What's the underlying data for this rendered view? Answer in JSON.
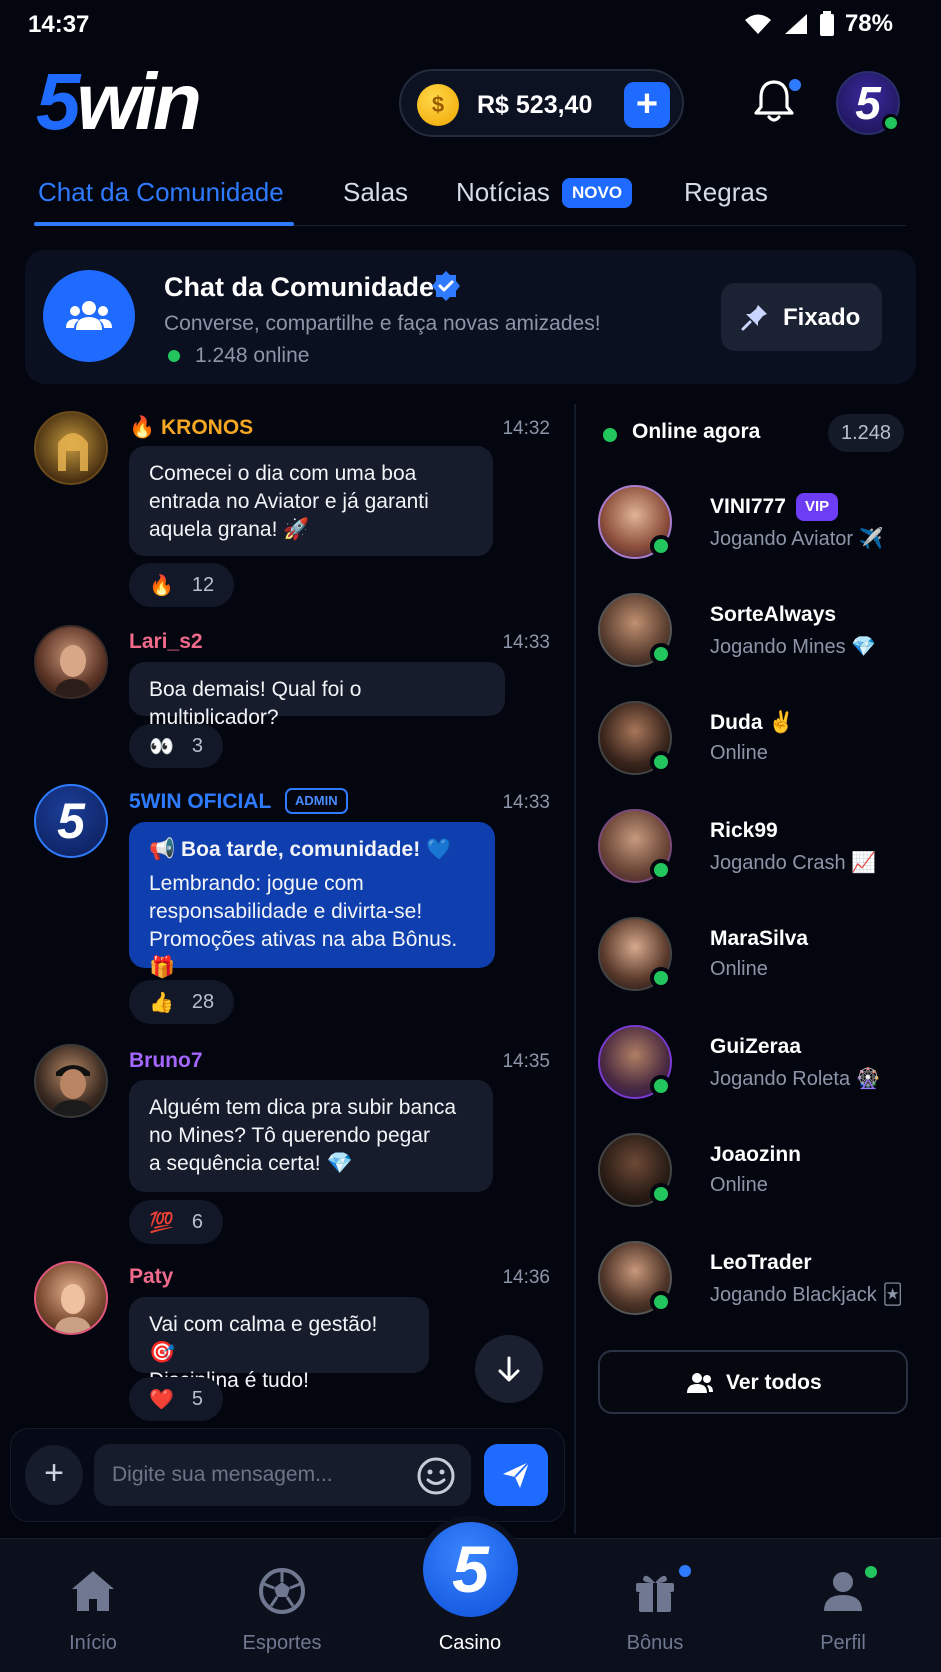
{
  "status_bar": {
    "time": "14:37",
    "battery": "78%"
  },
  "header": {
    "logo_five": "5",
    "logo_win": "win",
    "balance": "R$ 523,40",
    "add_label": "+",
    "avatar_label": "5"
  },
  "tabs": [
    {
      "label": "Chat da Comunidade",
      "active": true
    },
    {
      "label": "Salas"
    },
    {
      "label": "Notícias",
      "badge": "NOVO"
    },
    {
      "label": "Regras"
    }
  ],
  "community": {
    "title": "Chat da Comunidade",
    "subtitle": "Converse, compartilhe e faça novas amizades!",
    "online": "1.248 online",
    "pinned_label": "Fixado"
  },
  "messages": [
    {
      "name": "🔥 KRONOS",
      "name_color": "#f5a623",
      "time": "14:32",
      "lines": [
        "Comecei o dia com uma boa",
        "entrada no Aviator e já garanti",
        "aquela grana! 🚀"
      ],
      "reaction": "🔥",
      "count": "12"
    },
    {
      "name": "Lari_s2",
      "name_color": "#f06a8c",
      "time": "14:33",
      "lines": [
        "Boa demais! Qual foi o multiplicador?"
      ],
      "reaction": "👀",
      "count": "3"
    },
    {
      "name": "5WIN OFICIAL",
      "name_color": "#2f7bff",
      "badge": "ADMIN",
      "time": "14:33",
      "heading": "📢 Boa tarde, comunidade! 💙",
      "lines": [
        "Lembrando: jogue com",
        "responsabilidade e divirta-se!",
        "Promoções ativas na aba Bônus. 🎁"
      ],
      "reaction": "👍",
      "count": "28"
    },
    {
      "name": "Bruno7",
      "name_color": "#a466ff",
      "time": "14:35",
      "lines": [
        "Alguém tem dica pra subir banca",
        "no Mines? Tô querendo pegar",
        "a sequência certa! 💎"
      ],
      "reaction": "💯",
      "count": "6"
    },
    {
      "name": "Paty",
      "name_color": "#f06a8c",
      "time": "14:36",
      "lines": [
        "Vai com calma e gestão! 🎯",
        "Disciplina é tudo!"
      ],
      "reaction": "❤️",
      "count": "5"
    }
  ],
  "composer": {
    "placeholder": "Digite sua mensagem...",
    "plus": "+"
  },
  "online_panel": {
    "title": "Online agora",
    "count": "1.248",
    "users": [
      {
        "name": "VINI777",
        "badge": "VIP",
        "status": "Jogando Aviator ✈️"
      },
      {
        "name": "SorteAlways",
        "status": "Jogando Mines 💎"
      },
      {
        "name": "Duda ✌️",
        "status": "Online"
      },
      {
        "name": "Rick99",
        "status": "Jogando Crash 📈"
      },
      {
        "name": "MaraSilva",
        "status": "Online"
      },
      {
        "name": "GuiZeraa",
        "status": "Jogando Roleta 🎡"
      },
      {
        "name": "Joaozinn",
        "status": "Online"
      },
      {
        "name": "LeoTrader",
        "status": "Jogando Blackjack 🃏"
      }
    ],
    "see_all": "Ver todos"
  },
  "bottom_nav": {
    "items": [
      "Início",
      "Esportes",
      "Casino",
      "Bônus",
      "Perfil"
    ],
    "casino_logo": "5"
  },
  "colors": {
    "accent": "#1f6bff",
    "online": "#22c55e",
    "background": "#03060f"
  }
}
